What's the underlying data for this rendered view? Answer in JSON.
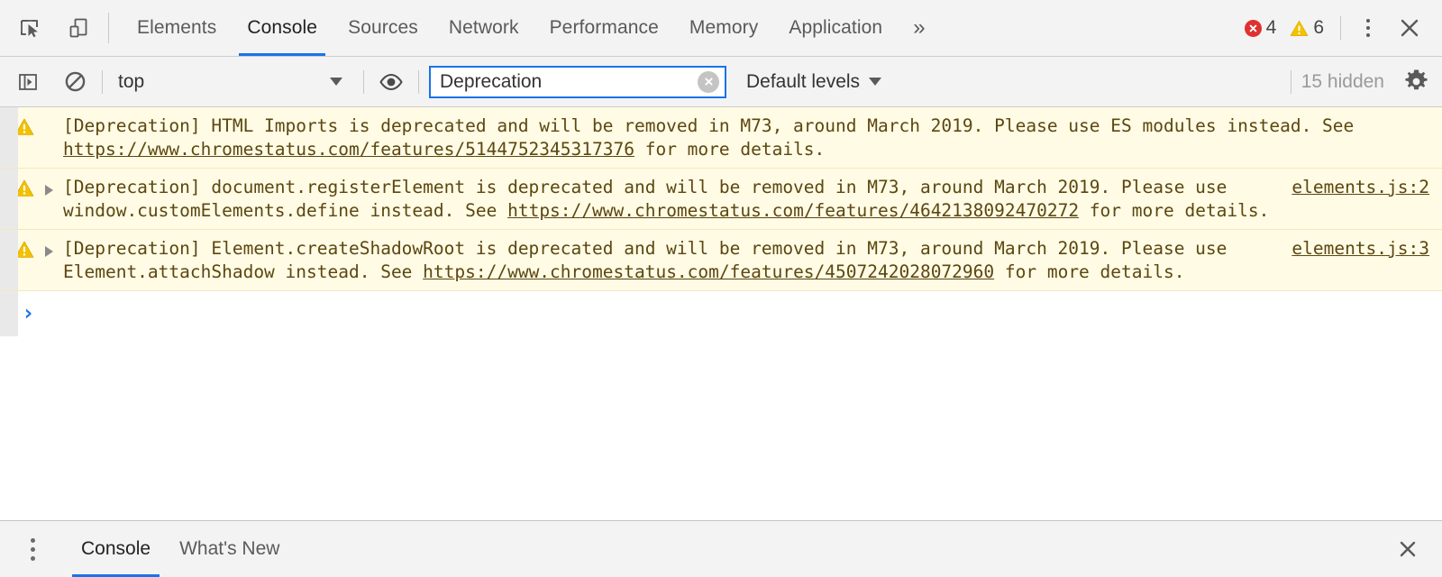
{
  "toolbar": {
    "inspect_icon": "inspect-element-icon",
    "device_icon": "device-toggle-icon",
    "tabs": [
      {
        "label": "Elements",
        "active": false
      },
      {
        "label": "Console",
        "active": true
      },
      {
        "label": "Sources",
        "active": false
      },
      {
        "label": "Network",
        "active": false
      },
      {
        "label": "Performance",
        "active": false
      },
      {
        "label": "Memory",
        "active": false
      },
      {
        "label": "Application",
        "active": false
      }
    ],
    "more_tabs_label": "»",
    "error_count": "4",
    "warning_count": "6",
    "error_color": "#e03030",
    "warning_color": "#f2c200",
    "accent_color": "#1a73e8",
    "kebab_label": "more-options",
    "close_label": "close-devtools"
  },
  "filterbar": {
    "sidebar_toggle_icon": "console-sidebar-icon",
    "clear_console_icon": "clear-console-icon",
    "context_selected": "top",
    "eye_icon": "live-expression-icon",
    "filter_value": "Deprecation",
    "filter_placeholder": "Filter",
    "clear_filter_icon": "clear-input-icon",
    "levels_label": "Default levels",
    "hidden_label": "15 hidden",
    "settings_icon": "settings-gear-icon"
  },
  "console": {
    "messages": [
      {
        "level": "warning",
        "expandable": false,
        "text_before": "[Deprecation] HTML Imports is deprecated and will be removed in M73, around March 2019. Please use ES modules instead. See ",
        "link": "https://www.chromestatus.com/features/5144752345317376",
        "text_after": " for more details.",
        "source": ""
      },
      {
        "level": "warning",
        "expandable": true,
        "text_before": "[Deprecation] document.registerElement is deprecated and will be removed in M73, around March 2019. Please use window.customElements.define instead. See ",
        "link": "https://www.chromestatus.com/features/4642138092470272",
        "text_after": " for more details.",
        "source": "elements.js:2"
      },
      {
        "level": "warning",
        "expandable": true,
        "text_before": "[Deprecation] Element.createShadowRoot is deprecated and will be removed in M73, around March 2019. Please use Element.attachShadow instead. See ",
        "link": "https://www.chromestatus.com/features/4507242028072960",
        "text_after": " for more details.",
        "source": "elements.js:3"
      }
    ],
    "prompt_chevron": "›",
    "prompt_value": "",
    "message_bg": "#fffbe5",
    "message_text_color": "#5c4710"
  },
  "drawer": {
    "kebab_label": "drawer-more-options",
    "tabs": [
      {
        "label": "Console",
        "active": true
      },
      {
        "label": "What's New",
        "active": false
      }
    ],
    "close_label": "close-drawer"
  }
}
